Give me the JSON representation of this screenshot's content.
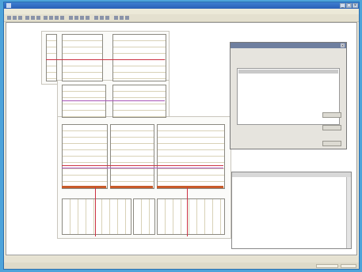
{
  "window": {
    "title": "",
    "colors": {
      "desktop": "#4da3da",
      "titlebar": "#2a5fb6",
      "accent_line": "#cc3344",
      "purple_line": "#a855b8",
      "thick_line": "#c85a2a"
    }
  },
  "titlebar": {
    "minimize": "_",
    "maximize": "□",
    "close": "×",
    "icons": [
      "app-icon"
    ]
  },
  "menubar": {
    "items": []
  },
  "toolbar": {
    "tools": [
      "tool-1",
      "tool-2",
      "tool-3",
      "tool-4",
      "tool-5",
      "tool-6",
      "tool-7",
      "tool-8",
      "tool-9",
      "tool-10",
      "tool-11",
      "tool-12",
      "tool-13",
      "tool-14",
      "tool-15",
      "tool-16",
      "tool-17",
      "tool-18",
      "tool-19",
      "tool-20"
    ]
  },
  "dialog": {
    "title": "",
    "close": "×",
    "labels": [
      "",
      ""
    ],
    "list_rows": [
      "",
      "",
      ""
    ],
    "footer_labels": [
      "",
      "",
      ""
    ],
    "buttons": [
      "",
      "",
      ""
    ]
  },
  "console": {
    "lines": [
      "",
      "",
      "",
      "",
      "",
      "",
      "",
      "",
      "",
      "",
      "",
      "",
      "",
      "",
      ""
    ]
  },
  "status": {
    "text": "",
    "text2": ""
  }
}
